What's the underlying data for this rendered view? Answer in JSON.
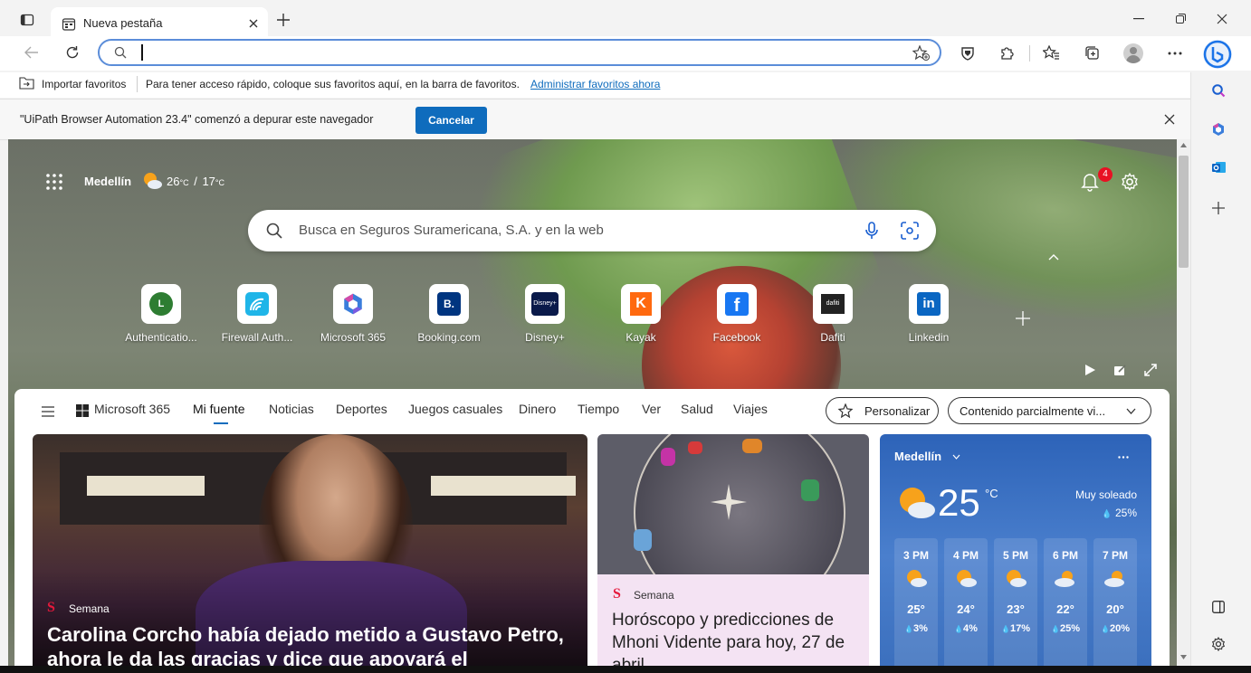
{
  "browser": {
    "tab_title": "Nueva pestaña",
    "address_value": ""
  },
  "favorites_bar": {
    "import_label": "Importar favoritos",
    "hint": "Para tener acceso rápido, coloque sus favoritos aquí, en la barra de favoritos.",
    "manage_link": "Administrar favoritos ahora"
  },
  "debug_bar": {
    "message": "\"UiPath Browser Automation 23.4\" comenzó a depurar este navegador",
    "cancel_label": "Cancelar"
  },
  "newtab": {
    "city": "Medellín",
    "temp_high": "26",
    "temp_low": "17",
    "temp_unit": "°C",
    "separator": "/",
    "notifications_count": "4",
    "search_placeholder": "Busca en Seguros Suramericana, S.A. y en la web",
    "quick_links": [
      {
        "label": "Authenticatio...",
        "icon": "L"
      },
      {
        "label": "Firewall Auth...",
        "icon": "wifi"
      },
      {
        "label": "Microsoft 365",
        "icon": "m365"
      },
      {
        "label": "Booking.com",
        "icon": "B."
      },
      {
        "label": "Disney+",
        "icon": "Disney+"
      },
      {
        "label": "Kayak",
        "icon": "K"
      },
      {
        "label": "Facebook",
        "icon": "f"
      },
      {
        "label": "Dafiti",
        "icon": "dafiti"
      },
      {
        "label": "Linkedin",
        "icon": "in"
      }
    ]
  },
  "feed_nav": {
    "items": [
      "Microsoft 365",
      "Mi fuente",
      "Noticias",
      "Deportes",
      "Juegos casuales",
      "Dinero",
      "Tiempo",
      "Ver",
      "Salud",
      "Viajes"
    ],
    "active": "Mi fuente",
    "personalize_label": "Personalizar",
    "content_filter_label": "Contenido parcialmente vi..."
  },
  "cards": {
    "main": {
      "source": "Semana",
      "headline": "Carolina Corcho había dejado metido a Gustavo Petro, ahora le da las gracias y dice que apoyará el"
    },
    "second": {
      "source": "Semana",
      "headline": "Horóscopo y predicciones de Mhoni Vidente para hoy, 27 de abril"
    },
    "weather": {
      "city": "Medellín",
      "temp": "25",
      "unit": "°C",
      "condition": "Muy soleado",
      "precip": "25%",
      "hours": [
        {
          "time": "3 PM",
          "temp": "25°",
          "precip": "3%"
        },
        {
          "time": "4 PM",
          "temp": "24°",
          "precip": "4%"
        },
        {
          "time": "5 PM",
          "temp": "23°",
          "precip": "17%"
        },
        {
          "time": "6 PM",
          "temp": "22°",
          "precip": "25%"
        },
        {
          "time": "7 PM",
          "temp": "20°",
          "precip": "20%"
        }
      ]
    }
  },
  "colors": {
    "accent": "#0f6cbd",
    "weather_bg": "#2d63b8",
    "badge": "#e81123"
  }
}
